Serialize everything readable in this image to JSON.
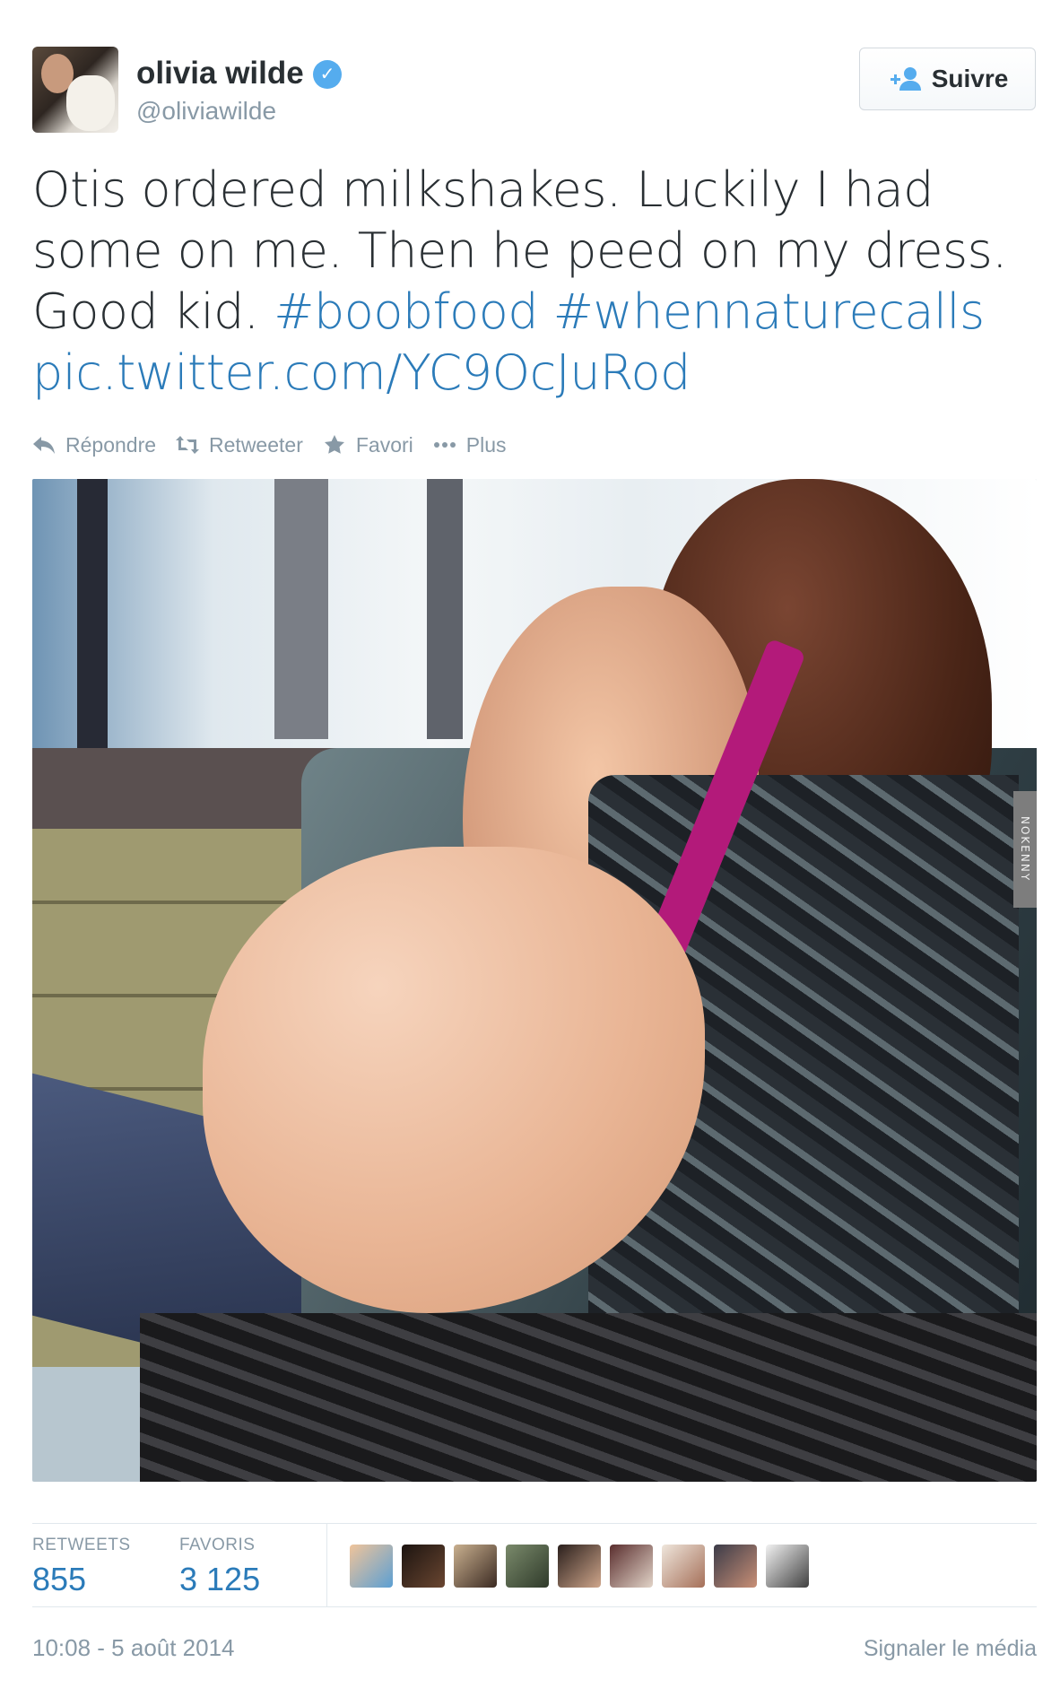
{
  "user": {
    "display_name": "olivia wilde",
    "handle": "@oliviawilde",
    "verified": true,
    "verified_icon": "✓"
  },
  "follow_button": {
    "label": "Suivre",
    "icon": "add-user-icon"
  },
  "tweet": {
    "text_plain": "Otis ordered milkshakes. Luckily I had some on me. Then he peed on my dress. Good kid.",
    "hashtags": [
      "#boobfood",
      "#whennaturecalls"
    ],
    "link": "pic.twitter.com/YC9OcJuRod"
  },
  "actions": [
    {
      "label": "Répondre",
      "icon": "reply-icon"
    },
    {
      "label": "Retweeter",
      "icon": "retweet-icon"
    },
    {
      "label": "Favori",
      "icon": "star-icon"
    },
    {
      "label": "Plus",
      "icon": "more-icon"
    }
  ],
  "photo": {
    "watermark": "NOKENNY"
  },
  "stats": {
    "retweets_label": "RETWEETS",
    "retweets_value": "855",
    "favorites_label": "FAVORIS",
    "favorites_value": "3 125"
  },
  "favoriters": [
    {
      "colors": [
        "#f0c49a",
        "#5b9fd3"
      ]
    },
    {
      "colors": [
        "#1c1410",
        "#6a4631"
      ]
    },
    {
      "colors": [
        "#c9b08f",
        "#3b2a22"
      ]
    },
    {
      "colors": [
        "#7a8a6b",
        "#2f3a2a"
      ]
    },
    {
      "colors": [
        "#2a1f1c",
        "#cfa68b"
      ]
    },
    {
      "colors": [
        "#5a2e2e",
        "#e2d4c8"
      ]
    },
    {
      "colors": [
        "#efe6dc",
        "#a56f58"
      ]
    },
    {
      "colors": [
        "#3b3b48",
        "#c98f76"
      ]
    },
    {
      "colors": [
        "#f2f2f2",
        "#404040"
      ]
    }
  ],
  "footer": {
    "timestamp": "10:08 - 5 août 2014",
    "report_label": "Signaler le média"
  },
  "colors": {
    "link": "#2b7bb9",
    "muted": "#8899a6",
    "verified": "#55acee"
  }
}
